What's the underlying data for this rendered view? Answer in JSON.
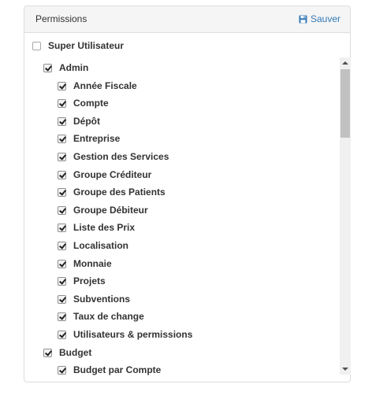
{
  "panel": {
    "title": "Permissions",
    "save_label": "Sauver",
    "save_icon": "floppy-disk-icon",
    "accent": "#337ab7"
  },
  "tree": {
    "root": {
      "label": "Super Utilisateur",
      "checked": false
    },
    "groups": [
      {
        "label": "Admin",
        "checked": true,
        "items": [
          {
            "label": "Année Fiscale",
            "checked": true
          },
          {
            "label": "Compte",
            "checked": true
          },
          {
            "label": "Dépôt",
            "checked": true
          },
          {
            "label": "Entreprise",
            "checked": true
          },
          {
            "label": "Gestion des Services",
            "checked": true
          },
          {
            "label": "Groupe Créditeur",
            "checked": true
          },
          {
            "label": "Groupe des Patients",
            "checked": true
          },
          {
            "label": "Groupe Débiteur",
            "checked": true
          },
          {
            "label": "Liste des Prix",
            "checked": true
          },
          {
            "label": "Localisation",
            "checked": true
          },
          {
            "label": "Monnaie",
            "checked": true
          },
          {
            "label": "Projets",
            "checked": true
          },
          {
            "label": "Subventions",
            "checked": true
          },
          {
            "label": "Taux de change",
            "checked": true
          },
          {
            "label": "Utilisateurs & permissions",
            "checked": true
          }
        ]
      },
      {
        "label": "Budget",
        "checked": true,
        "items": [
          {
            "label": "Budget par Compte",
            "checked": true
          }
        ]
      }
    ]
  }
}
